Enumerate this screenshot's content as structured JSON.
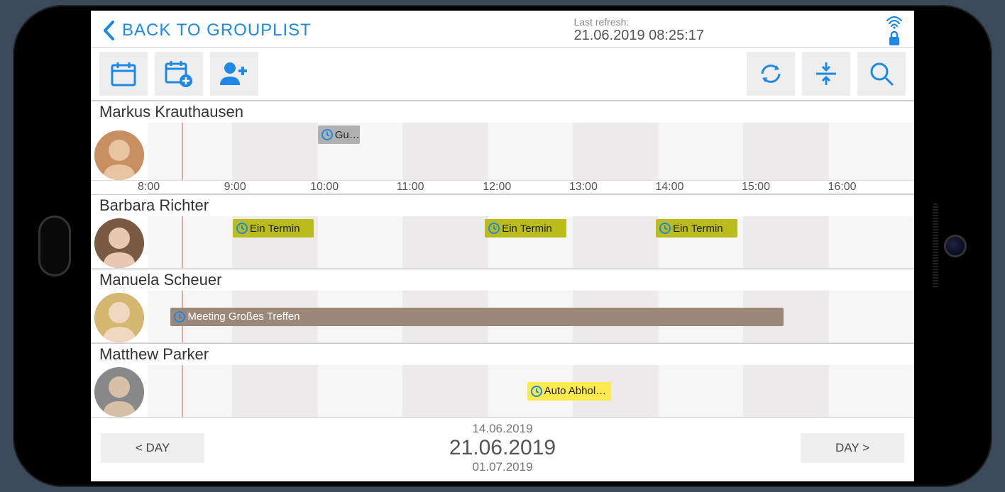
{
  "header": {
    "back_label": "BACK TO GROUPLIST",
    "last_refresh_label": "Last refresh:",
    "last_refresh_time": "21.06.2019 08:25:17"
  },
  "timeline": {
    "hours": [
      "8:00",
      "9:00",
      "10:00",
      "11:00",
      "12:00",
      "13:00",
      "14:00",
      "15:00",
      "16:00"
    ],
    "now_position_pct": 4.4
  },
  "people": [
    {
      "name": "Markus Krauthausen",
      "events": [
        {
          "title": "Gu…",
          "start_pct": 22.2,
          "width_pct": 5.5,
          "style": "gray"
        }
      ]
    },
    {
      "name": "Barbara Richter",
      "events": [
        {
          "title": "Ein Termin",
          "start_pct": 11.1,
          "width_pct": 10.6,
          "style": "olive"
        },
        {
          "title": "Ein Termin",
          "start_pct": 44.0,
          "width_pct": 10.6,
          "style": "olive"
        },
        {
          "title": "Ein Termin",
          "start_pct": 66.3,
          "width_pct": 10.6,
          "style": "olive"
        }
      ]
    },
    {
      "name": "Manuela Scheuer",
      "events": [
        {
          "title": "Meeting Großes Treffen",
          "start_pct": 3.0,
          "width_pct": 80.0,
          "style": "brown",
          "middle": true
        }
      ]
    },
    {
      "name": "Matthew Parker",
      "events": [
        {
          "title": "Auto Abhol…",
          "start_pct": 49.5,
          "width_pct": 11.0,
          "style": "yellow",
          "middle": true
        }
      ]
    }
  ],
  "footer": {
    "prev_label": "< DAY",
    "next_label": "DAY >",
    "date_prev": "14.06.2019",
    "date_main": "21.06.2019",
    "date_next": "01.07.2019"
  }
}
